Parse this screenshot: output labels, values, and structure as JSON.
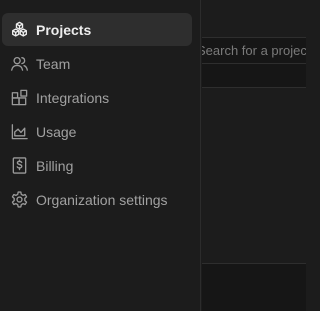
{
  "sidebar": {
    "items": [
      {
        "label": "Projects",
        "icon": "cubes-icon",
        "active": true
      },
      {
        "label": "Team",
        "icon": "users-icon",
        "active": false
      },
      {
        "label": "Integrations",
        "icon": "blocks-icon",
        "active": false
      },
      {
        "label": "Usage",
        "icon": "chart-icon",
        "active": false
      },
      {
        "label": "Billing",
        "icon": "dollar-receipt-icon",
        "active": false
      },
      {
        "label": "Organization settings",
        "icon": "gear-icon",
        "active": false
      }
    ]
  },
  "main": {
    "search": {
      "placeholder": "Search for a project"
    }
  },
  "colors": {
    "background": "#1c1c1c",
    "active_item": "#2e2e2e",
    "text_active": "#ededed",
    "text_muted": "#a1a1a1"
  }
}
